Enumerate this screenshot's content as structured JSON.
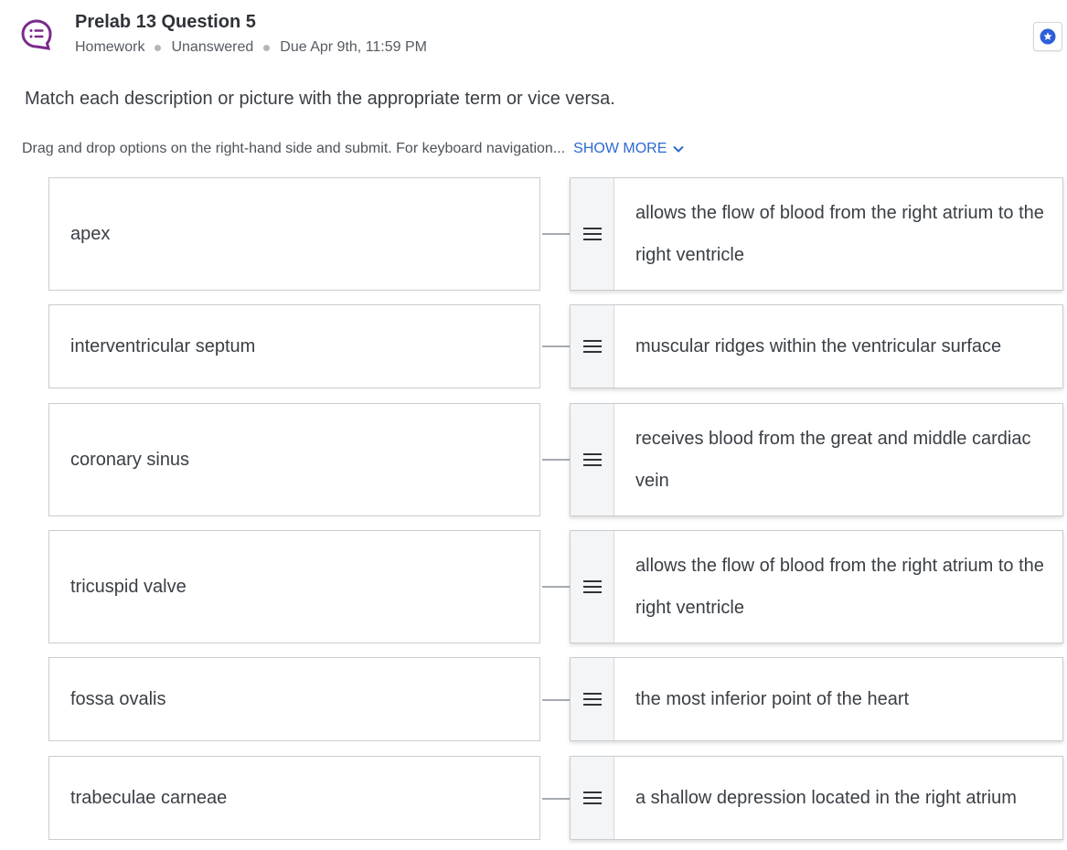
{
  "header": {
    "title": "Prelab 13 Question 5",
    "meta": [
      "Homework",
      "Unanswered",
      "Due Apr 9th, 11:59 PM"
    ],
    "question_icon": "chat-list-icon",
    "favorite_icon": "star-icon"
  },
  "instruction": "Match each description or picture with the appropriate term or vice versa.",
  "sub": {
    "text": "Drag and drop options on the right-hand side and submit. For keyboard navigation...",
    "show_more": "SHOW MORE"
  },
  "pairs": [
    {
      "term": "apex",
      "description": "allows the flow of blood from the right atrium to the right ventricle"
    },
    {
      "term": "interventricular septum",
      "description": "muscular ridges within the ventricular surface"
    },
    {
      "term": "coronary sinus",
      "description": "receives blood from the great and middle cardiac vein"
    },
    {
      "term": "tricuspid valve",
      "description": "allows the flow of blood from the right atrium to the right ventricle"
    },
    {
      "term": "fossa ovalis",
      "description": "the most inferior point of the heart"
    },
    {
      "term": "trabeculae carneae",
      "description": "a shallow depression located in the right atrium"
    }
  ],
  "colors": {
    "accent_purple": "#7a2a8a",
    "link_blue": "#2c6ad0",
    "star_blue": "#2d5fd6"
  }
}
